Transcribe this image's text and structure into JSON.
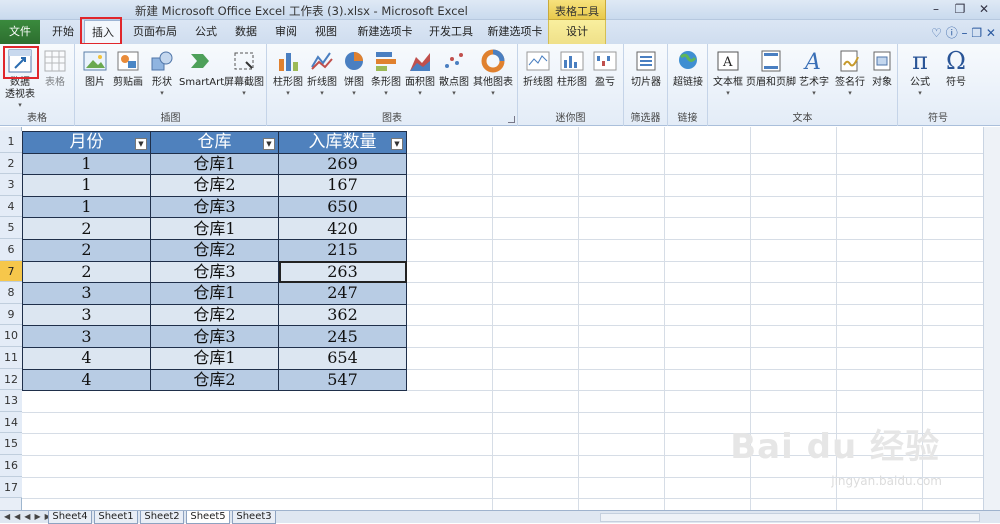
{
  "window": {
    "title": "新建 Microsoft Office Excel 工作表 (3).xlsx  -  Microsoft Excel",
    "contextual_tab_group": "表格工具"
  },
  "tabs": [
    {
      "label": "文件"
    },
    {
      "label": "开始"
    },
    {
      "label": "插入"
    },
    {
      "label": "页面布局"
    },
    {
      "label": "公式"
    },
    {
      "label": "数据"
    },
    {
      "label": "审阅"
    },
    {
      "label": "视图"
    },
    {
      "label": "新建选项卡"
    },
    {
      "label": "开发工具"
    },
    {
      "label": "新建选项卡"
    },
    {
      "label": "设计"
    }
  ],
  "ribbon": {
    "groups": {
      "tables": "表格",
      "illustrations": "插图",
      "charts": "图表",
      "sparklines": "迷你图",
      "filter": "筛选器",
      "links": "链接",
      "text": "文本",
      "symbols": "符号"
    },
    "buttons": {
      "pivot_table_line1": "数据",
      "pivot_table_line2": "透视表",
      "table": "表格",
      "picture": "图片",
      "clip_art": "剪贴画",
      "shapes": "形状",
      "smartart": "SmartArt",
      "screenshot": "屏幕截图",
      "column_chart": "柱形图",
      "line_chart": "折线图",
      "pie_chart": "饼图",
      "bar_chart": "条形图",
      "area_chart": "面积图",
      "scatter_chart": "散点图",
      "other_charts": "其他图表",
      "spark_line": "折线图",
      "spark_column": "柱形图",
      "spark_winloss": "盈亏",
      "slicer": "切片器",
      "hyperlink": "超链接",
      "textbox": "文本框",
      "header_footer": "页眉和页脚",
      "wordart": "艺术字",
      "signature": "签名行",
      "object": "对象",
      "equation": "公式",
      "symbol": "符号"
    }
  },
  "grid": {
    "row_numbers": [
      "1",
      "2",
      "3",
      "4",
      "5",
      "6",
      "7",
      "8",
      "9",
      "10",
      "11",
      "12",
      "13",
      "14",
      "15",
      "16",
      "17"
    ],
    "selected_row": "7"
  },
  "table": {
    "headers": [
      "月份",
      "仓库",
      "入库数量"
    ],
    "rows": [
      [
        "1",
        "仓库1",
        "269"
      ],
      [
        "1",
        "仓库2",
        "167"
      ],
      [
        "1",
        "仓库3",
        "650"
      ],
      [
        "2",
        "仓库1",
        "420"
      ],
      [
        "2",
        "仓库2",
        "215"
      ],
      [
        "2",
        "仓库3",
        "263"
      ],
      [
        "3",
        "仓库1",
        "247"
      ],
      [
        "3",
        "仓库2",
        "362"
      ],
      [
        "3",
        "仓库3",
        "245"
      ],
      [
        "4",
        "仓库1",
        "654"
      ],
      [
        "4",
        "仓库2",
        "547"
      ]
    ]
  },
  "sheet_tabs": [
    "Sheet4",
    "Sheet1",
    "Sheet2",
    "Sheet5",
    "Sheet3"
  ],
  "active_sheet": "Sheet5",
  "watermark": {
    "brand": "Bai du 经验",
    "url": "jingyan.baidu.com"
  },
  "colors": {
    "header_fill": "#4f81bd",
    "band_dark": "#b8cce4",
    "band_light": "#dce6f1",
    "highlight": "#e0262b"
  }
}
